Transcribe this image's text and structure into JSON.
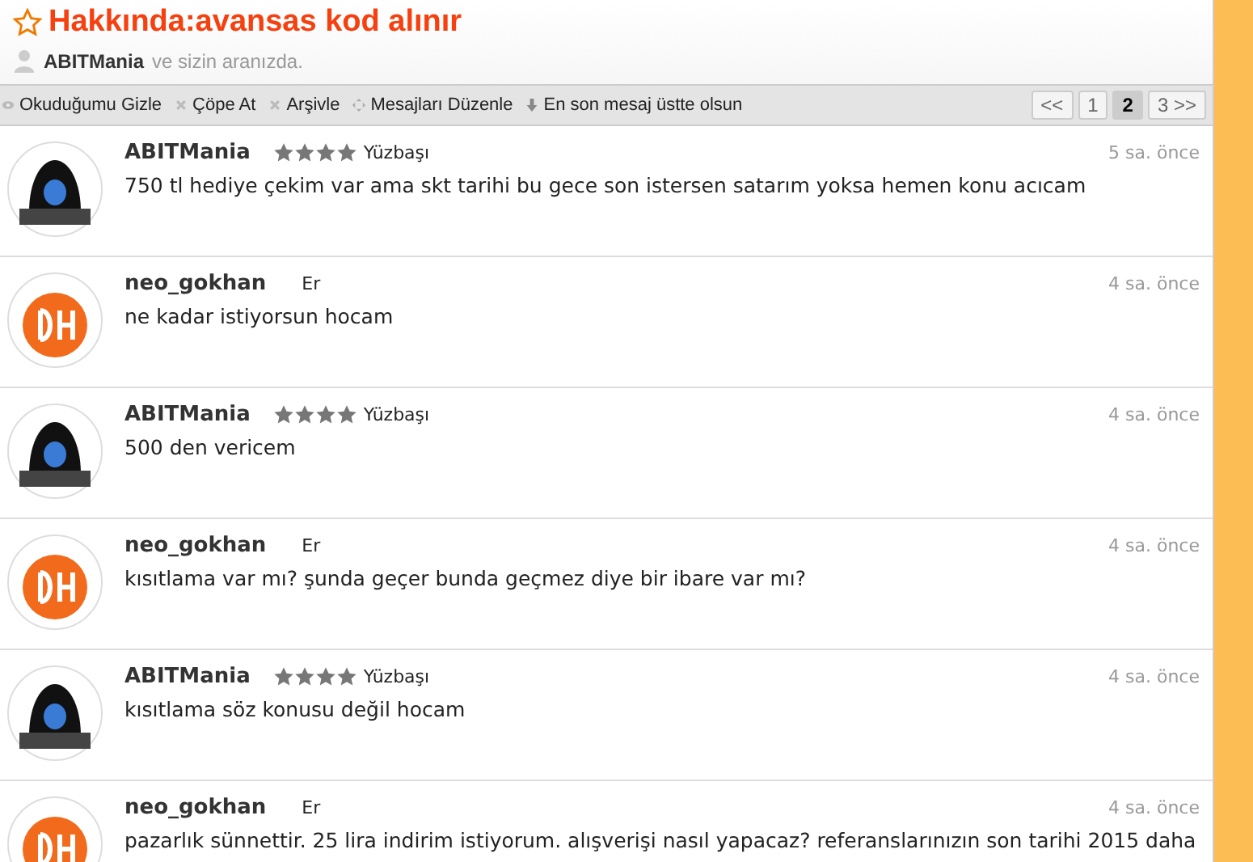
{
  "header": {
    "title": "Hakkında:avansas kod alınır",
    "participant": "ABITMania",
    "participants_suffix": "ve sizin aranızda."
  },
  "toolbar": {
    "actions": [
      {
        "label": "Okuduğumu Gizle",
        "kind": "eye"
      },
      {
        "label": "Çöpe At",
        "kind": "x"
      },
      {
        "label": "Arşivle",
        "kind": "x"
      },
      {
        "label": "Mesajları Düzenle",
        "kind": "move"
      },
      {
        "label": "En son mesaj üstte olsun",
        "kind": "down"
      }
    ],
    "pagination": [
      {
        "label": "<<",
        "selected": false
      },
      {
        "label": "1",
        "selected": false
      },
      {
        "label": "2",
        "selected": true
      },
      {
        "label": "3 >>",
        "selected": false
      }
    ]
  },
  "messages": [
    {
      "author": "ABITMania",
      "kind": "hood",
      "stars": 4,
      "rank": "Yüzbaşı",
      "time": "5 sa. önce",
      "text": "750 tl hediye çekim var ama skt tarihi bu gece son istersen satarım yoksa hemen konu acıcam"
    },
    {
      "author": "neo_gokhan",
      "kind": "logo",
      "rank": "Er",
      "time": "4 sa. önce",
      "text": "ne kadar istiyorsun hocam"
    },
    {
      "author": "ABITMania",
      "kind": "hood",
      "stars": 4,
      "rank": "Yüzbaşı",
      "time": "4 sa. önce",
      "text": "500 den vericem"
    },
    {
      "author": "neo_gokhan",
      "kind": "logo",
      "rank": "Er",
      "time": "4 sa. önce",
      "text": "kısıtlama var mı? şunda geçer bunda geçmez diye bir ibare var mı?"
    },
    {
      "author": "ABITMania",
      "kind": "hood",
      "stars": 4,
      "rank": "Yüzbaşı",
      "time": "4 sa. önce",
      "text": "kısıtlama söz konusu değil hocam"
    },
    {
      "author": "neo_gokhan",
      "kind": "logo",
      "rank": "Er",
      "time": "4 sa. önce",
      "text": "pazarlık sünnettir. 25 lira indirim istiyorum. alışverişi nasıl yapacaz? referanslarınızın son tarihi 2015 daha"
    }
  ]
}
